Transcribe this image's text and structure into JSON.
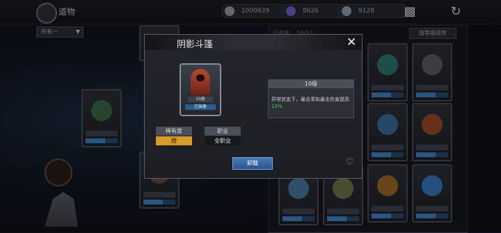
{
  "header": {
    "title": "道物"
  },
  "resources": [
    {
      "name": "coin",
      "value": "1000839",
      "color": "#9aa0aa"
    },
    {
      "name": "crystal",
      "value": "8626",
      "color": "#7b5bd6"
    },
    {
      "name": "token",
      "value": "9128",
      "color": "#8fa3b8"
    }
  ],
  "filter": {
    "selected": "所有一"
  },
  "collection": {
    "label": "已收集：",
    "count": "58/93"
  },
  "sort_button": "按等级排序",
  "modal": {
    "title": "阴影斗篷",
    "item_card": {
      "level": "10级",
      "equipped": "已装备"
    },
    "info": {
      "level": "10级",
      "text_prefix": "异常状态下，暴击率和暴击伤害提高",
      "bonus": "12%"
    },
    "rarity": {
      "label": "稀有度",
      "value": "橙"
    },
    "job": {
      "label": "职业",
      "value": "全职业"
    },
    "unload_button": "卸载"
  }
}
